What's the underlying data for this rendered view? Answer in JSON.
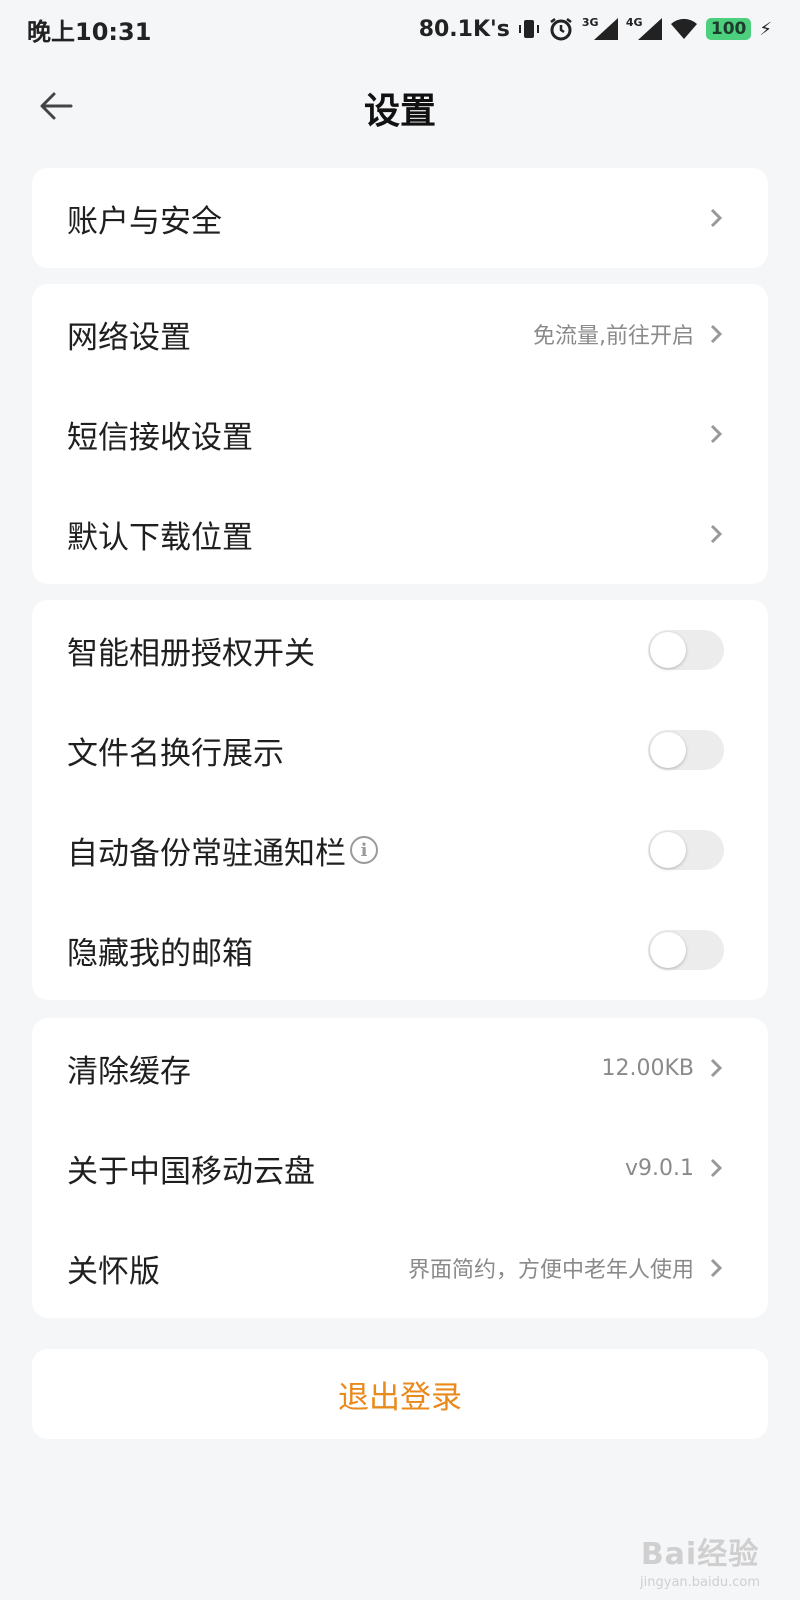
{
  "status_bar": {
    "time": "晚上10:31",
    "speed": "80.1K's",
    "sig1_label": "3G",
    "sig2_label": "4G",
    "battery": "100"
  },
  "header": {
    "title": "设置"
  },
  "account": {
    "label": "账户与安全"
  },
  "network": {
    "label": "网络设置",
    "value": "免流量,前往开启"
  },
  "sms": {
    "label": "短信接收设置"
  },
  "download": {
    "label": "默认下载位置"
  },
  "toggles": [
    {
      "label": "智能相册授权开关",
      "on": false
    },
    {
      "label": "文件名换行展示",
      "on": false
    },
    {
      "label": "自动备份常驻通知栏",
      "on": false
    },
    {
      "label": "隐藏我的邮箱",
      "on": false
    }
  ],
  "cache": {
    "label": "清除缓存",
    "value": "12.00KB"
  },
  "about": {
    "label": "关于中国移动云盘",
    "value": "v9.0.1"
  },
  "care": {
    "label": "关怀版",
    "value": "界面简约，方便中老年人使用"
  },
  "logout": {
    "label": "退出登录"
  },
  "watermark": {
    "main": "Bai经验",
    "sub": "jingyan.baidu.com"
  },
  "colors": {
    "accent": "#ea8a1c",
    "background": "#f5f6f8"
  }
}
